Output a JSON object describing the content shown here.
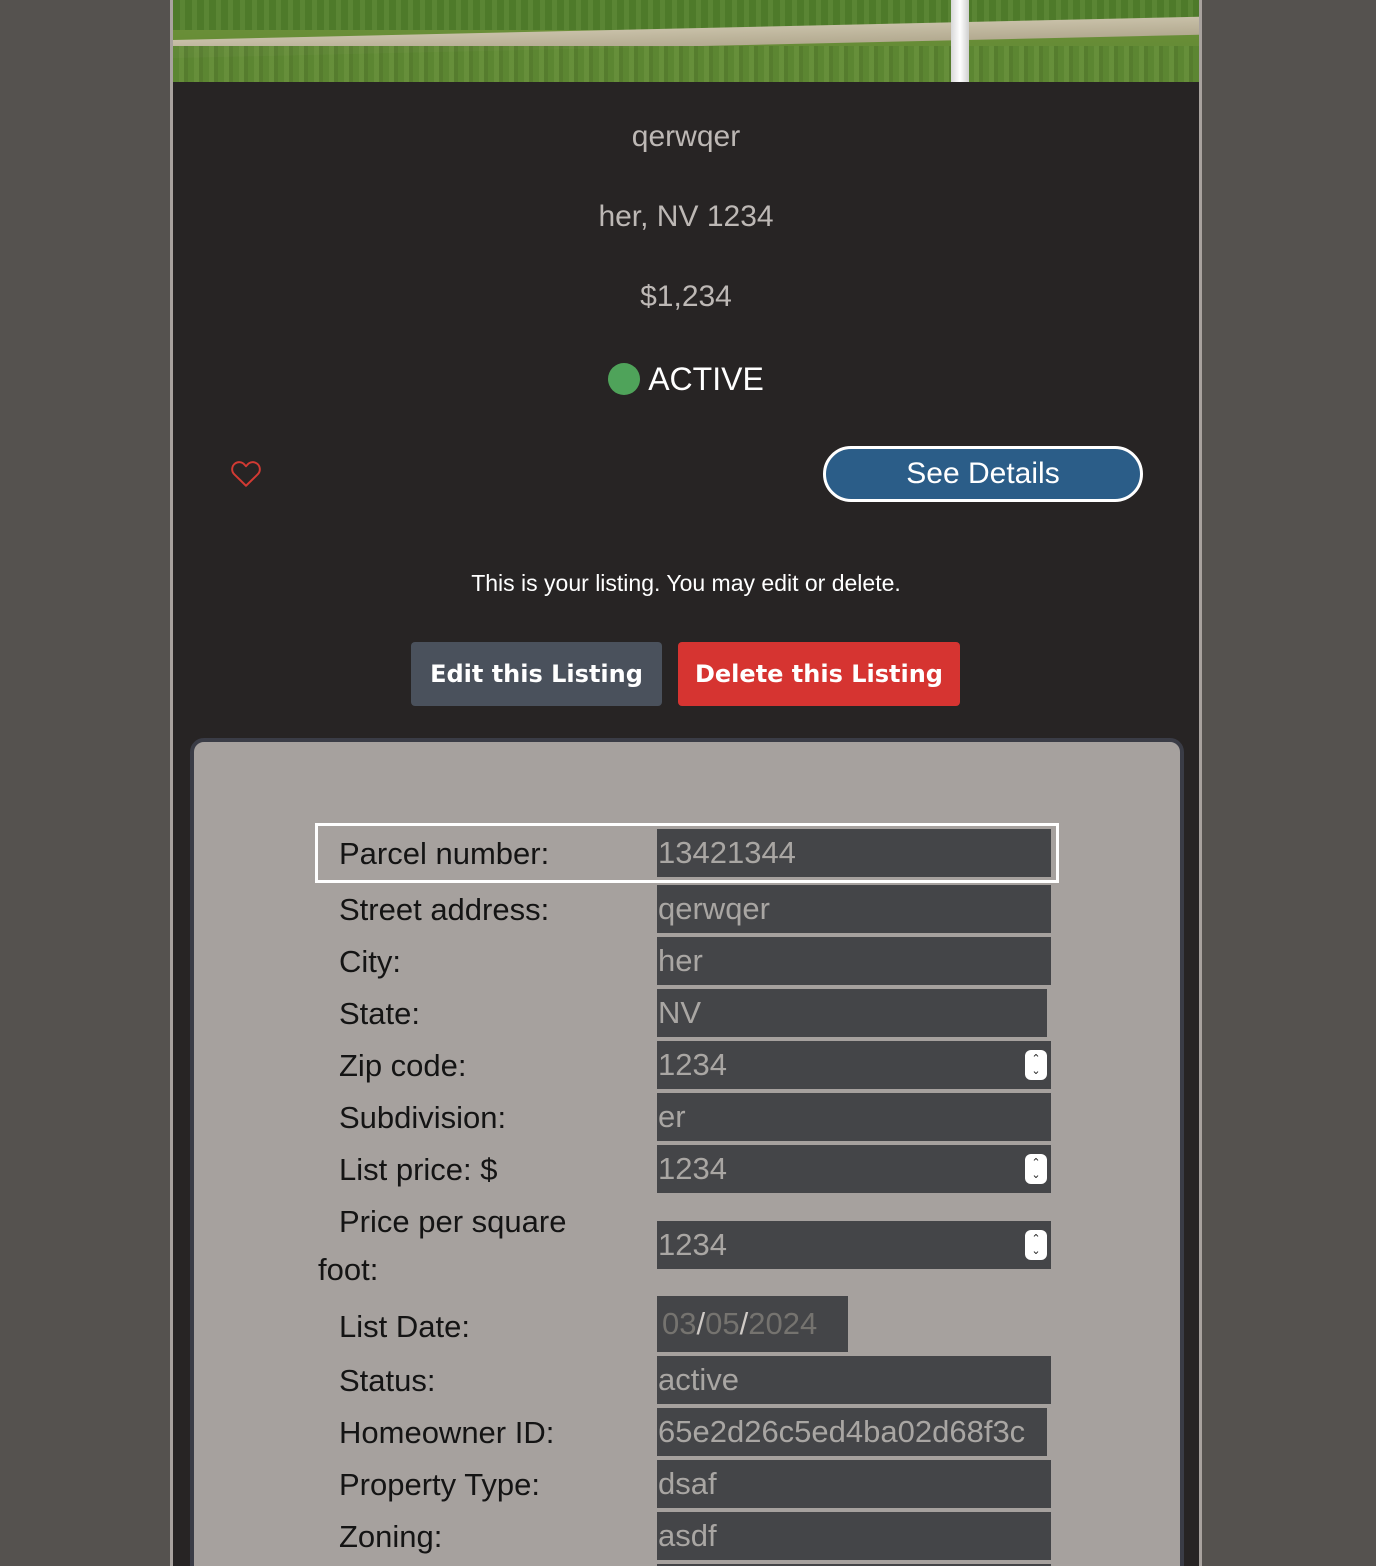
{
  "listing": {
    "street": "qerwqer",
    "city_state_zip": "her, NV 1234",
    "price": "$1,234",
    "status": "ACTIVE",
    "status_color": "#4fa35a"
  },
  "actions": {
    "favorite_icon": "heart-outline-icon",
    "see_details_label": "See Details",
    "owner_note": "This is your listing. You may edit or delete.",
    "edit_label": "Edit this Listing",
    "delete_label": "Delete this Listing"
  },
  "form": {
    "parcel_number": {
      "label": "Parcel number:",
      "value": "13421344"
    },
    "street_address": {
      "label": "Street address:",
      "value": "qerwqer"
    },
    "city": {
      "label": "City:",
      "value": "her"
    },
    "state": {
      "label": "State:",
      "value": "NV"
    },
    "zip_code": {
      "label": "Zip code:",
      "value": "1234"
    },
    "subdivision": {
      "label": "Subdivision:",
      "value": "er"
    },
    "list_price": {
      "label": "List price: $",
      "value": "1234"
    },
    "price_per_sqft": {
      "label_line1": "Price per square",
      "label_line2": "foot:",
      "value": "1234"
    },
    "list_date": {
      "label": "List Date:",
      "month": "03",
      "day": "05",
      "year": "2024",
      "separator": "/"
    },
    "status": {
      "label": "Status:",
      "value": "active"
    },
    "homeowner_id": {
      "label": "Homeowner ID:",
      "value": "65e2d26c5ed4ba02d68f3c"
    },
    "property_type": {
      "label": "Property Type:",
      "value": "dsaf"
    },
    "zoning": {
      "label": "Zoning:",
      "value": "asdf"
    }
  }
}
